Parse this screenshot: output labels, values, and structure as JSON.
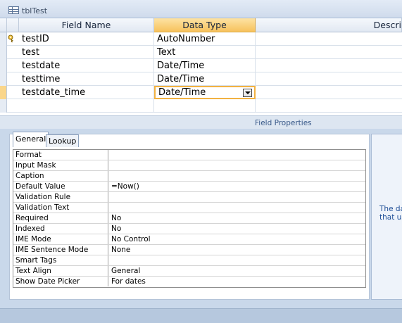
{
  "window": {
    "title": "tblTest"
  },
  "grid": {
    "columns": [
      "Field Name",
      "Data Type",
      "Descri"
    ],
    "rows": [
      {
        "field": "testID",
        "type": "AutoNumber",
        "primary_key": true
      },
      {
        "field": "test",
        "type": "Text"
      },
      {
        "field": "testdate",
        "type": "Date/Time"
      },
      {
        "field": "testtime",
        "type": "Date/Time"
      },
      {
        "field": "testdate_time",
        "type": "Date/Time",
        "current": true
      }
    ]
  },
  "field_properties": {
    "title": "Field Properties",
    "tabs": [
      "General",
      "Lookup"
    ],
    "rows": [
      {
        "name": "Format",
        "value": ""
      },
      {
        "name": "Input Mask",
        "value": ""
      },
      {
        "name": "Caption",
        "value": ""
      },
      {
        "name": "Default Value",
        "value": "=Now()"
      },
      {
        "name": "Validation Rule",
        "value": ""
      },
      {
        "name": "Validation Text",
        "value": ""
      },
      {
        "name": "Required",
        "value": "No"
      },
      {
        "name": "Indexed",
        "value": "No"
      },
      {
        "name": "IME Mode",
        "value": "No Control"
      },
      {
        "name": "IME Sentence Mode",
        "value": "None"
      },
      {
        "name": "Smart Tags",
        "value": ""
      },
      {
        "name": "Text Align",
        "value": "General"
      },
      {
        "name": "Show Date Picker",
        "value": "For dates"
      }
    ]
  },
  "help": {
    "line1": "The da",
    "line2": "that us"
  },
  "colors": {
    "active_header": "#f7c25c",
    "current_row_selector": "#fad68a",
    "help_text": "#1d4d96"
  },
  "icons": {
    "key": "primary-key-icon",
    "table": "table-icon"
  }
}
